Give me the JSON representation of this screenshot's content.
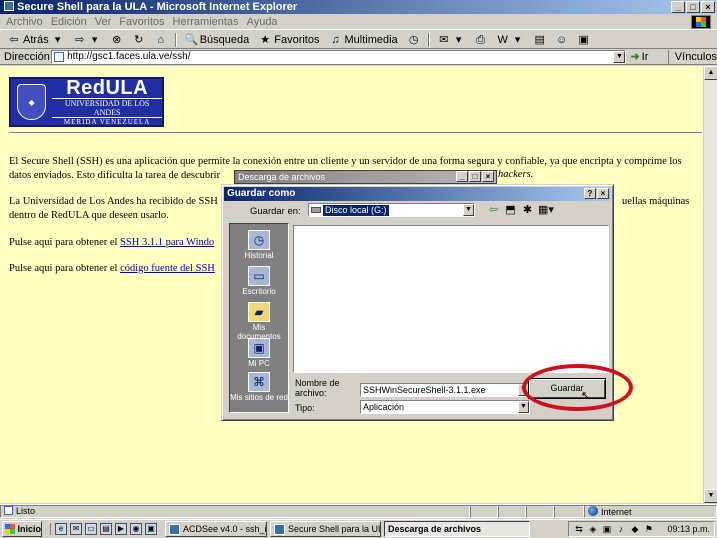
{
  "window": {
    "title": "Secure Shell para la ULA - Microsoft Internet Explorer"
  },
  "menu": {
    "items": [
      "Archivo",
      "Edición",
      "Ver",
      "Favoritos",
      "Herramientas",
      "Ayuda"
    ]
  },
  "toolbar": {
    "back": "Atrás",
    "search": "Búsqueda",
    "favorites": "Favoritos",
    "multimedia": "Multimedia"
  },
  "address": {
    "label": "Dirección",
    "url": "http://gsc1.faces.ula.ve/ssh/",
    "go": "Ir",
    "links": "Vínculos"
  },
  "logo": {
    "main": "RedULA",
    "sub1": "UNIVERSIDAD DE LOS ANDES",
    "sub2": "MERIDA VENEZUELA"
  },
  "page": {
    "p1_line1": "El Secure Shell (SSH) es una aplicación que permite la conexión entre un cliente y un servidor de una forma segura y confiable, ya que encripta y comprime los",
    "p1_line2a": "datos enviados. Esto dificulta la tarea de descubrir",
    "p1_line2b": "hackers.",
    "p2_line1a": "La Universidad de Los Andes ha recibido de SSH",
    "p2_line1b": "uellas máquinas",
    "p2_line2": "dentro de RedULA que deseen usarlo.",
    "p3_text": "Pulse aqui para obtener el",
    "p3_link": "SSH 3.1.1 para Windo",
    "p4_text": "Pulse aqui para obtener el",
    "p4_link": "código fuente del SSH"
  },
  "download_window": {
    "title": "Descarga de archivos"
  },
  "save_dialog": {
    "title": "Guardar como",
    "save_in_label": "Guardar en:",
    "save_in_value": "Disco local (G:)",
    "places": [
      "Historial",
      "Escritorio",
      "Mis documentos",
      "Mi PC",
      "Mis sitios de red"
    ],
    "filename_label_1": "Nombre de",
    "filename_label_2": "archivo:",
    "filename_value": "SSHWinSecureShell-3.1.1.exe",
    "type_label": "Tipo:",
    "type_value": "Aplicación",
    "save_button": "Guardar",
    "highlight_color": "#cc1020"
  },
  "status": {
    "text": "Listo",
    "zone": "Internet"
  },
  "taskbar": {
    "start": "Inicio",
    "tasks": [
      "ACDSee v4.0 - ssh_img",
      "Secure Shell para la ULA -...",
      "Descarga de archivos"
    ],
    "clock": "09:13 p.m."
  },
  "colors": {
    "page_bg": "#ffffc0",
    "titlebar": "#0a246a",
    "link": "#0000cc"
  }
}
